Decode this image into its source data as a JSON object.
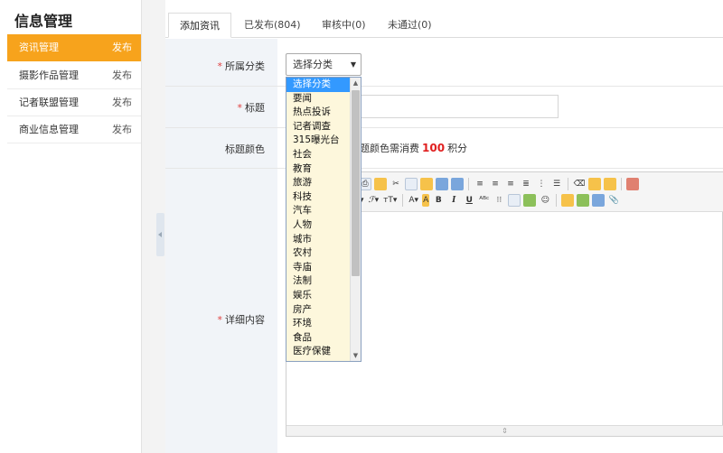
{
  "sidebar": {
    "title": "信息管理",
    "items": [
      {
        "label": "资讯管理",
        "action": "发布",
        "active": true
      },
      {
        "label": "摄影作品管理",
        "action": "发布",
        "active": false
      },
      {
        "label": "记者联盟管理",
        "action": "发布",
        "active": false
      },
      {
        "label": "商业信息管理",
        "action": "发布",
        "active": false
      }
    ]
  },
  "tabs": [
    {
      "label": "添加资讯",
      "active": true
    },
    {
      "label": "已发布(804)",
      "active": false
    },
    {
      "label": "审核中(0)",
      "active": false
    },
    {
      "label": "未通过(0)",
      "active": false
    }
  ],
  "form": {
    "category_label": "所属分类",
    "category_required_mark": "*",
    "category_value": "选择分类",
    "title_label": "标题",
    "title_required_mark": "*",
    "title_value": "",
    "color_label": "标题颜色",
    "color_note_prefix": "题颜色需消费",
    "color_note_points": "100",
    "color_note_suffix": "积分",
    "content_label": "详细内容",
    "content_required_mark": "*"
  },
  "dropdown": {
    "options": [
      "选择分类",
      "要闻",
      "热点投诉",
      "记者调查",
      "315曝光台",
      "社会",
      "教育",
      "旅游",
      "科技",
      "汽车",
      "人物",
      "城市",
      "农村",
      "寺庙",
      "法制",
      "娱乐",
      "房产",
      "环境",
      "食品",
      "医疗保健"
    ],
    "selected_index": 0
  },
  "colors": {
    "accent": "#f7a31c",
    "selected": "#3399ff",
    "required": "#e04040",
    "points": "#e02020"
  }
}
